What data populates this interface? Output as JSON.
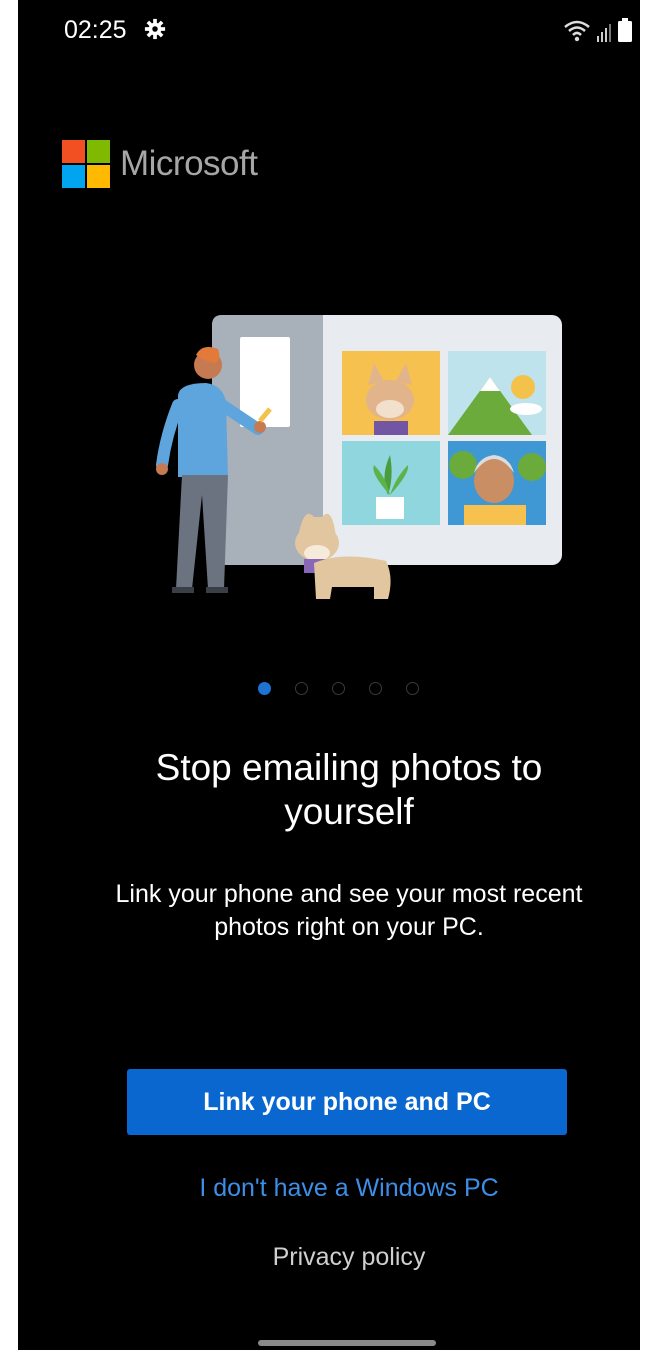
{
  "status_bar": {
    "time": "02:25",
    "icons": [
      "settings-gear-icon",
      "wifi-icon",
      "signal-icon",
      "battery-icon"
    ]
  },
  "brand": {
    "logo_text": "Microsoft",
    "logo_colors": [
      "#f25022",
      "#7fba00",
      "#00a4ef",
      "#ffb900"
    ]
  },
  "carousel": {
    "page_count": 5,
    "active_index": 0
  },
  "onboarding": {
    "headline_line1": "Stop emailing photos to",
    "headline_line2": "yourself",
    "description_line1": "Link your phone and see your most recent",
    "description_line2": "photos right on your PC."
  },
  "actions": {
    "primary_label": "Link your phone and PC",
    "secondary_label": "I don't have a Windows PC",
    "privacy_label": "Privacy policy"
  },
  "colors": {
    "background": "#000000",
    "accent": "#0a67d0",
    "link": "#3d8ee6",
    "dot_active": "#1e73d2"
  }
}
